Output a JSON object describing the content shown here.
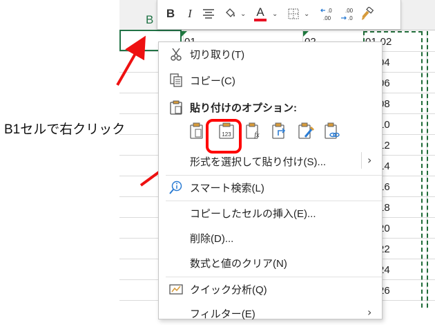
{
  "sheet": {
    "column_label": "B",
    "cell_b1_text": "01",
    "cell_c1_text": "02",
    "d_column_values": [
      "01-02",
      "-04",
      "-06",
      "-08",
      "-10",
      "-12",
      "-14",
      "-16",
      "-18",
      "-20",
      "-22",
      "-24",
      "-26"
    ]
  },
  "note": "B1セルで右クリック",
  "toolbar": {
    "bold": "B",
    "italic": "I",
    "font_color_letter": "A",
    "dec_increase": ".0→.00",
    "dec_decrease": ".00→.0",
    "font_color_hex": "#e81123"
  },
  "menu": {
    "cut": "切り取り(T)",
    "copy": "コピー(C)",
    "paste_options_heading": "貼り付けのオプション:",
    "paste_special": "形式を選択して貼り付け(S)...",
    "smart_lookup": "スマート検索(L)",
    "insert_copied": "コピーしたセルの挿入(E)...",
    "delete": "削除(D)...",
    "clear_contents": "数式と値のクリア(N)",
    "quick_analysis": "クイック分析(Q)",
    "filter_partial": "フィルター(E)"
  },
  "colors": {
    "excel_green": "#217346",
    "highlight_red": "#ff0000",
    "arrow_red": "#ee1111"
  }
}
